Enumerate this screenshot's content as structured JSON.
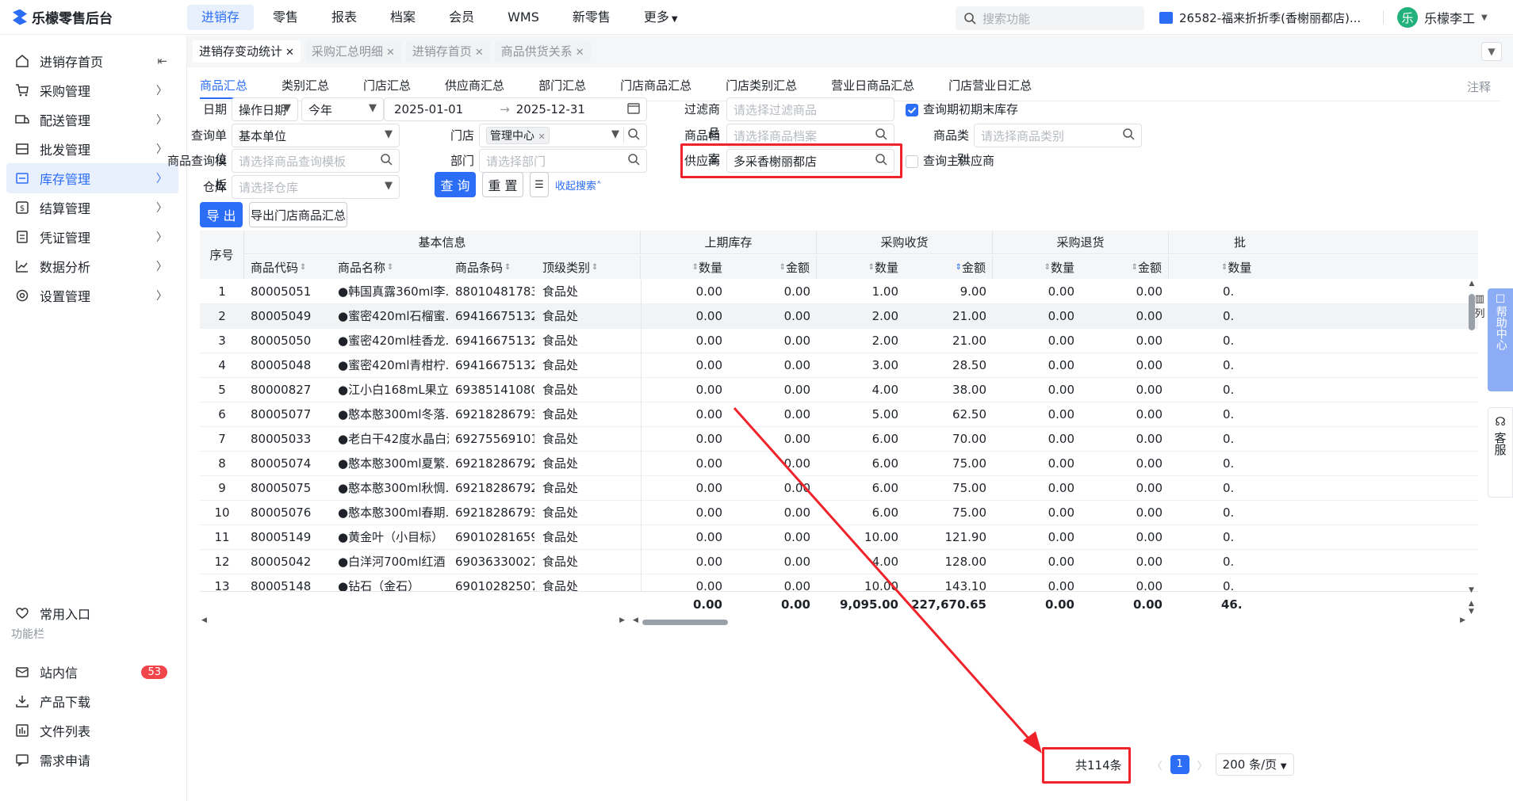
{
  "app": {
    "title": "乐檬零售后台"
  },
  "topnav": [
    "进销存",
    "零售",
    "报表",
    "档案",
    "会员",
    "WMS",
    "新零售",
    "更多"
  ],
  "search": {
    "placeholder": "搜索功能"
  },
  "store": "26582-福来折折季(香榭丽都店)...",
  "user": {
    "avatar": "乐",
    "name": "乐檬李工"
  },
  "sidebar": {
    "items": [
      "进销存首页",
      "采购管理",
      "配送管理",
      "批发管理",
      "库存管理",
      "结算管理",
      "凭证管理",
      "数据分析",
      "设置管理"
    ],
    "common": "常用入口",
    "section": "功能栏",
    "tools": [
      "站内信",
      "产品下载",
      "文件列表",
      "需求申请"
    ],
    "badge": "53"
  },
  "tabs": [
    {
      "label": "进销存变动统计"
    },
    {
      "label": "采购汇总明细"
    },
    {
      "label": "进销存首页"
    },
    {
      "label": "商品供货关系"
    }
  ],
  "subtabs": [
    "商品汇总",
    "类别汇总",
    "门店汇总",
    "供应商汇总",
    "部门汇总",
    "门店商品汇总",
    "门店类别汇总",
    "营业日商品汇总",
    "门店营业日汇总"
  ],
  "notes": "注释",
  "filters": {
    "date_label": "日期",
    "date_type": "操作日期",
    "date_preset": "今年",
    "date_start": "2025-01-01",
    "date_end": "2025-12-31",
    "unit_label": "查询单位",
    "unit": "基本单位",
    "template_label": "商品查询模板",
    "template_ph": "请选择商品查询模板",
    "warehouse_label": "仓库",
    "warehouse_ph": "请选择仓库",
    "store_label": "门店",
    "store_tag": "管理中心",
    "dept_label": "部门",
    "dept_ph": "请选择部门",
    "filter_label": "过滤商品",
    "filter_ph": "请选择过滤商品",
    "goods_label": "商品档案",
    "goods_ph": "请选择商品档案",
    "supplier_label": "供应商",
    "supplier": "多采香榭丽都店",
    "category_label": "商品类别",
    "category_ph": "请选择商品类别",
    "check_inventory": "查询期初期末库存",
    "check_main_supplier": "查询主供应商"
  },
  "buttons": {
    "query": "查 询",
    "reset": "重 置",
    "collapse": "收起搜索",
    "export": "导 出",
    "export_store": "导出门店商品汇总"
  },
  "table": {
    "groups": [
      "基本信息",
      "上期库存",
      "采购收货",
      "采购退货",
      "批"
    ],
    "headers": {
      "seq": "序号",
      "code": "商品代码",
      "name": "商品名称",
      "barcode": "商品条码",
      "category": "顶级类别",
      "qty": "数量",
      "amount": "金额"
    },
    "rows": [
      [
        "1",
        "80005051",
        "●韩国真露360ml李...",
        "88010481783...",
        "食品处",
        "0.00",
        "0.00",
        "1.00",
        "9.00",
        "0.00",
        "0.00",
        "0."
      ],
      [
        "2",
        "80005049",
        "●蜜密420ml石榴蜜...",
        "69416675132...",
        "食品处",
        "0.00",
        "0.00",
        "2.00",
        "21.00",
        "0.00",
        "0.00",
        "0."
      ],
      [
        "3",
        "80005050",
        "●蜜密420ml桂香龙...",
        "69416675132...",
        "食品处",
        "0.00",
        "0.00",
        "2.00",
        "21.00",
        "0.00",
        "0.00",
        "0."
      ],
      [
        "4",
        "80005048",
        "●蜜密420ml青柑柠...",
        "69416675132...",
        "食品处",
        "0.00",
        "0.00",
        "3.00",
        "28.50",
        "0.00",
        "0.00",
        "0."
      ],
      [
        "5",
        "80000827",
        "●江小白168mL果立...",
        "69385141080...",
        "食品处",
        "0.00",
        "0.00",
        "4.00",
        "38.00",
        "0.00",
        "0.00",
        "0."
      ],
      [
        "6",
        "80005077",
        "●憨本憨300ml冬落...",
        "69218286793...",
        "食品处",
        "0.00",
        "0.00",
        "5.00",
        "62.50",
        "0.00",
        "0.00",
        "0."
      ],
      [
        "7",
        "80005033",
        "●老白干42度水晶白酒",
        "69275569101...",
        "食品处",
        "0.00",
        "0.00",
        "6.00",
        "70.00",
        "0.00",
        "0.00",
        "0."
      ],
      [
        "8",
        "80005074",
        "●憨本憨300ml夏繁...",
        "69218286792...",
        "食品处",
        "0.00",
        "0.00",
        "6.00",
        "75.00",
        "0.00",
        "0.00",
        "0."
      ],
      [
        "9",
        "80005075",
        "●憨本憨300ml秋惆...",
        "69218286792...",
        "食品处",
        "0.00",
        "0.00",
        "6.00",
        "75.00",
        "0.00",
        "0.00",
        "0."
      ],
      [
        "10",
        "80005076",
        "●憨本憨300ml春期...",
        "69218286793...",
        "食品处",
        "0.00",
        "0.00",
        "6.00",
        "75.00",
        "0.00",
        "0.00",
        "0."
      ],
      [
        "11",
        "80005149",
        "●黄金叶（小目标）",
        "69010281659...",
        "食品处",
        "0.00",
        "0.00",
        "10.00",
        "121.90",
        "0.00",
        "0.00",
        "0."
      ],
      [
        "12",
        "80005042",
        "●白洋河700ml红酒",
        "69036330027...",
        "食品处",
        "0.00",
        "0.00",
        "4.00",
        "128.00",
        "0.00",
        "0.00",
        "0."
      ],
      [
        "13",
        "80005148",
        "●钻石（金石）",
        "69010282507...",
        "食品处",
        "0.00",
        "0.00",
        "10.00",
        "143.10",
        "0.00",
        "0.00",
        "0."
      ]
    ],
    "totals": [
      "0.00",
      "0.00",
      "9,095.00",
      "227,670.65",
      "0.00",
      "0.00",
      "46."
    ]
  },
  "pager": {
    "total": "共114条",
    "page": "1",
    "size": "200 条/页"
  },
  "help": {
    "help_label": "帮助中心",
    "service_label": "客服",
    "column_label": "列"
  },
  "colors": {
    "accent": "#2c6df5",
    "highlight": "#f0222a"
  }
}
